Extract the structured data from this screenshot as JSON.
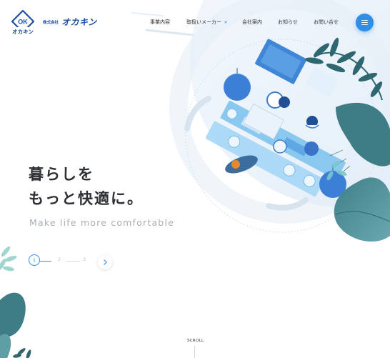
{
  "logo": {
    "mark_text": "OK",
    "mark_kana": "オカキン",
    "corp_prefix": "株式会社",
    "corp_name": "オカキン"
  },
  "nav": {
    "items": [
      {
        "label": "事業内容"
      },
      {
        "label": "取扱いメーカー"
      },
      {
        "label": "会社案内"
      },
      {
        "label": "お知らせ"
      },
      {
        "label": "お問い合せ"
      }
    ]
  },
  "hero": {
    "line1": "暮らしを",
    "line2": "もっと快適に。",
    "subtitle": "Make life more comfortable"
  },
  "pager": {
    "pages": [
      "1",
      "2",
      "3"
    ],
    "current": 1
  },
  "scroll_label": "SCROLL",
  "icons": [
    "menu-icon",
    "chevron-right-icon",
    "chevron-down-icon"
  ],
  "colors": {
    "accent": "#2f8ee8",
    "brand": "#1f4fa3",
    "text": "#2c2f33",
    "subtitle": "#a9b0b6"
  }
}
